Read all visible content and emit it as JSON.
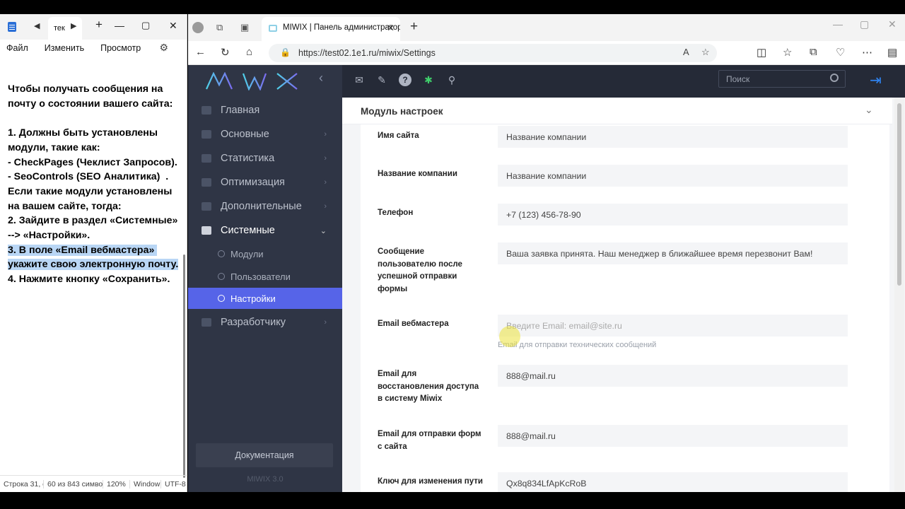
{
  "notepad": {
    "tab_title": "тек",
    "menu": [
      "Файл",
      "Изменить",
      "Просмотр"
    ],
    "text_before": "Чтобы получать сообщения на почту о состоянии вашего сайта:\n\n1. Должны быть установлены модули, такие как:\n- CheckPages (Чеклист Запросов).\n- SeoControls (SEO Аналитика)  .\nЕсли такие модули установлены на вашем сайте, тогда:\n2. Зайдите в раздел «Системные» --> «Настройки».\n",
    "text_highlighted": "3. В поле «Email вебмастера» укажите свою электронную почту.",
    "text_after": "\n4. Нажмите кнопку «Сохранить».",
    "status": {
      "position": "Строка 31, с",
      "chars": "60 из 843 симво",
      "zoom": "120%",
      "line_ending": "Window",
      "encoding": "UTF-8"
    }
  },
  "browser": {
    "tab_title": "MIWIX | Панель администратор",
    "url": "https://test02.1e1.ru/miwix/Settings"
  },
  "app": {
    "logo": "MIWIX",
    "search_placeholder": "Поиск",
    "nav": {
      "main": "Главная",
      "basic": "Основные",
      "stats": "Статистика",
      "optimization": "Оптимизация",
      "extra": "Дополнительные",
      "system": "Системные",
      "modules": "Модули",
      "users": "Пользователи",
      "settings": "Настройки",
      "developer": "Разработчику"
    },
    "docs_button": "Документация",
    "version": "MIWIX 3.0",
    "panel_title": "Модуль настроек",
    "fields": {
      "site_name": {
        "label": "Имя сайта",
        "value": "Название компании"
      },
      "company_name": {
        "label": "Название компании",
        "value": "Название компании"
      },
      "phone": {
        "label": "Телефон",
        "value": "+7 (123) 456-78-90"
      },
      "success_message": {
        "label": "Сообщение пользователю после успешной отправки формы",
        "value": "Ваша заявка принята. Наш менеджер в ближайшее время перезвонит Вам!"
      },
      "webmaster_email": {
        "label": "Email вебмастера",
        "placeholder": "Введите Email: email@site.ru",
        "help": "Email для отправки технических сообщений"
      },
      "recovery_email": {
        "label": "Email для восстановления доступа в систему Miwix",
        "value": "888@mail.ru"
      },
      "forms_email": {
        "label": "Email для отправки форм с сайта",
        "value": "888@mail.ru"
      },
      "path_key": {
        "label": "Ключ для изменения пути",
        "value": "Qx8q834LfApKcRoB"
      }
    }
  }
}
